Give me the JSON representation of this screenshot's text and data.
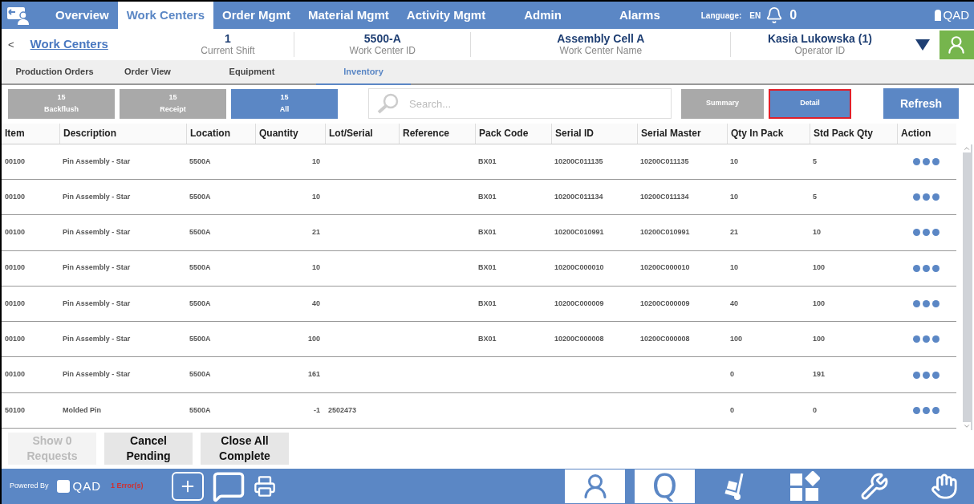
{
  "nav": {
    "tabs": [
      {
        "label": "Overview",
        "selected": false
      },
      {
        "label": "Work Centers",
        "selected": true
      },
      {
        "label": "Order Mgmt",
        "selected": false
      },
      {
        "label": "Material Mgmt",
        "selected": false
      },
      {
        "label": "Activity Mgmt",
        "selected": false
      },
      {
        "label": "Admin",
        "selected": false
      },
      {
        "label": "Alarms",
        "selected": false
      }
    ],
    "language_label": "Language:",
    "language": "EN",
    "alarm_count": "0",
    "logo": "QAD"
  },
  "header": {
    "back": "<",
    "title": "Work Centers",
    "fields": [
      {
        "value": "1",
        "label": "Current Shift"
      },
      {
        "value": "5500-A",
        "label": "Work Center ID"
      },
      {
        "value": "Assembly Cell A",
        "label": "Work Center Name"
      },
      {
        "value": "Kasia Lukowska (1)",
        "label": "Operator ID"
      }
    ]
  },
  "subtabs": [
    {
      "label": "Production Orders",
      "selected": false
    },
    {
      "label": "Order View",
      "selected": false
    },
    {
      "label": "Equipment",
      "selected": false
    },
    {
      "label": "Inventory",
      "selected": true
    }
  ],
  "filters": [
    {
      "count": "15",
      "label": "Backflush",
      "selected": false
    },
    {
      "count": "15",
      "label": "Receipt",
      "selected": false
    },
    {
      "count": "15",
      "label": "All",
      "selected": true
    }
  ],
  "search": {
    "placeholder": "Search..."
  },
  "views": [
    {
      "label": "Summary",
      "selected": false,
      "highlighted": false
    },
    {
      "label": "Detail",
      "selected": true,
      "highlighted": true
    }
  ],
  "refresh": "Refresh",
  "table": {
    "columns": [
      "Item",
      "Description",
      "Location",
      "Quantity",
      "Lot/Serial",
      "Reference",
      "Pack Code",
      "Serial ID",
      "Serial Master",
      "Qty In Pack",
      "Std Pack Qty",
      "Action"
    ],
    "rows": [
      [
        "00100",
        "Pin Assembly - Star",
        "5500A",
        "10",
        "",
        "",
        "BX01",
        "10200C011135",
        "10200C011135",
        "10",
        "5"
      ],
      [
        "00100",
        "Pin Assembly - Star",
        "5500A",
        "10",
        "",
        "",
        "BX01",
        "10200C011134",
        "10200C011134",
        "10",
        "5"
      ],
      [
        "00100",
        "Pin Assembly - Star",
        "5500A",
        "21",
        "",
        "",
        "BX01",
        "10200C010991",
        "10200C010991",
        "21",
        "10"
      ],
      [
        "00100",
        "Pin Assembly - Star",
        "5500A",
        "10",
        "",
        "",
        "BX01",
        "10200C000010",
        "10200C000010",
        "10",
        "100"
      ],
      [
        "00100",
        "Pin Assembly - Star",
        "5500A",
        "40",
        "",
        "",
        "BX01",
        "10200C000009",
        "10200C000009",
        "40",
        "100"
      ],
      [
        "00100",
        "Pin Assembly - Star",
        "5500A",
        "100",
        "",
        "",
        "BX01",
        "10200C000008",
        "10200C000008",
        "100",
        "100"
      ],
      [
        "00100",
        "Pin Assembly - Star",
        "5500A",
        "161",
        "",
        "",
        "",
        "",
        "",
        "0",
        "191"
      ],
      [
        "50100",
        "Molded Pin",
        "5500A",
        "-1",
        "2502473",
        "",
        "",
        "",
        "",
        "0",
        "0"
      ]
    ]
  },
  "actions": [
    {
      "label": "Show 0 Requests",
      "disabled": true
    },
    {
      "label": "Cancel Pending",
      "disabled": false
    },
    {
      "label": "Close All Complete",
      "disabled": false
    }
  ],
  "footer": {
    "powered_by": "Powered By",
    "logo": "QAD",
    "errors": "1 Error(s)",
    "tools": [
      {
        "kind": "add-note"
      },
      {
        "kind": "messages"
      },
      {
        "kind": "print"
      }
    ],
    "nav": [
      {
        "kind": "person",
        "selected": true
      },
      {
        "kind": "q",
        "text": "Q",
        "selected": true
      },
      {
        "kind": "cart",
        "selected": false
      },
      {
        "kind": "blocks",
        "selected": false
      },
      {
        "kind": "wrench",
        "selected": false
      },
      {
        "kind": "wave",
        "selected": false
      }
    ]
  }
}
